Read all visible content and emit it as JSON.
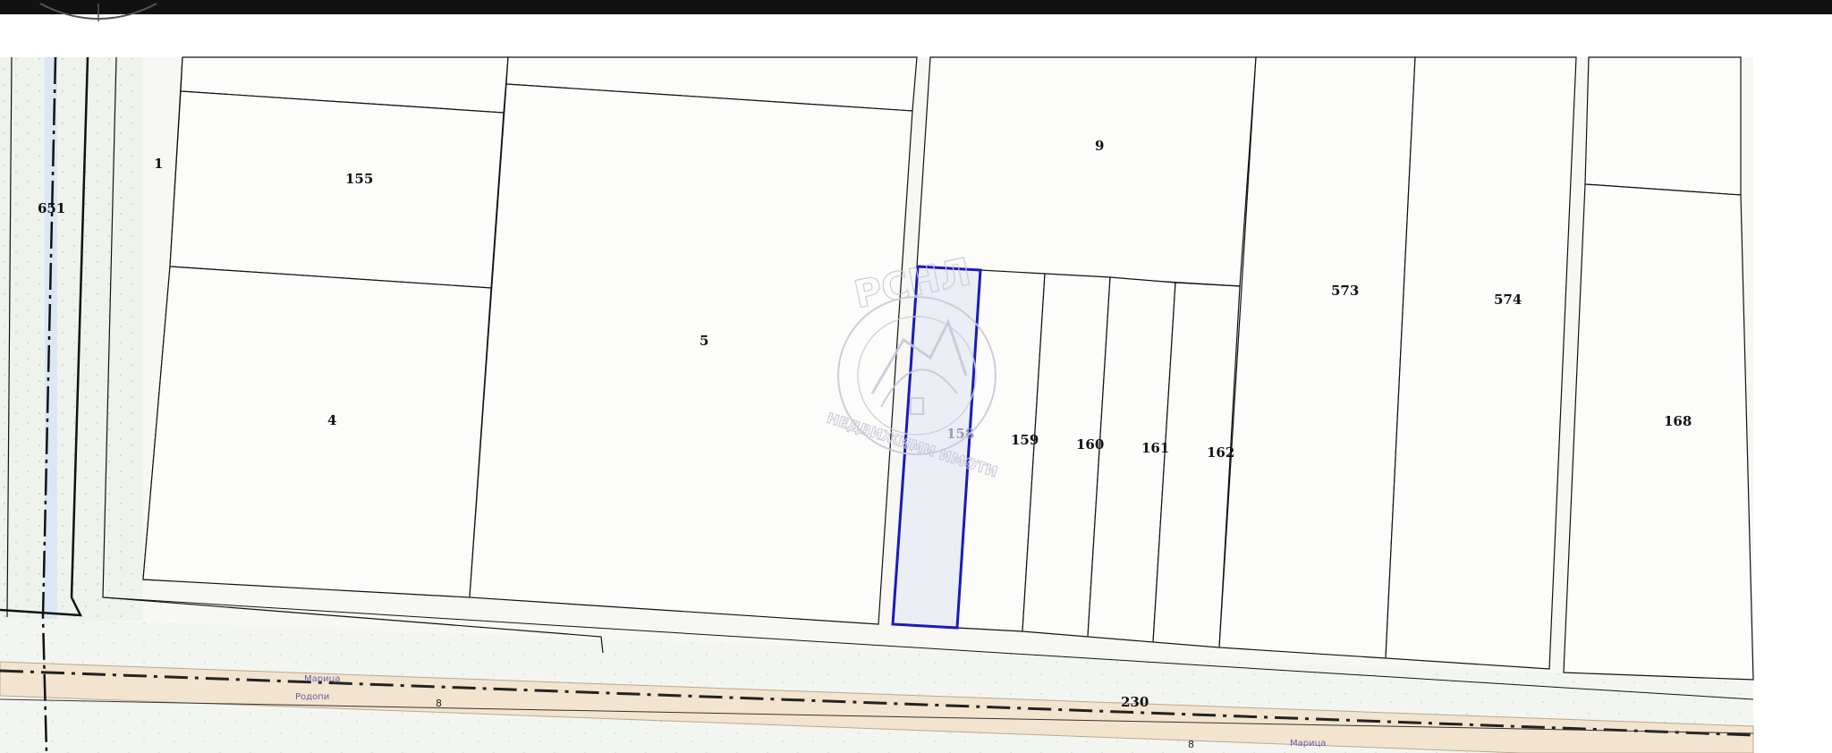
{
  "parcels": {
    "p651": "651",
    "p1": "1",
    "p155": "155",
    "p4": "4",
    "p5": "5",
    "p9": "9",
    "p158": "158",
    "p159": "159",
    "p160": "160",
    "p161": "161",
    "p162": "162",
    "p573": "573",
    "p574": "574",
    "p168": "168",
    "p230": "230"
  },
  "road": {
    "label_top_left": "Марица",
    "label_bottom_left": "Родопи",
    "number_left": "8",
    "number_right": "8",
    "label_right": "Марица"
  },
  "watermark": {
    "brand": "РСНЛ",
    "tagline": "НЕДВИЖИМИ ИМОТИ"
  },
  "colors": {
    "highlight": "#1a1ab8",
    "road_fill": "#f2e4cf",
    "background": "#f7f8f4",
    "parcel_fill": "#fcfcfa",
    "line": "#111111"
  }
}
